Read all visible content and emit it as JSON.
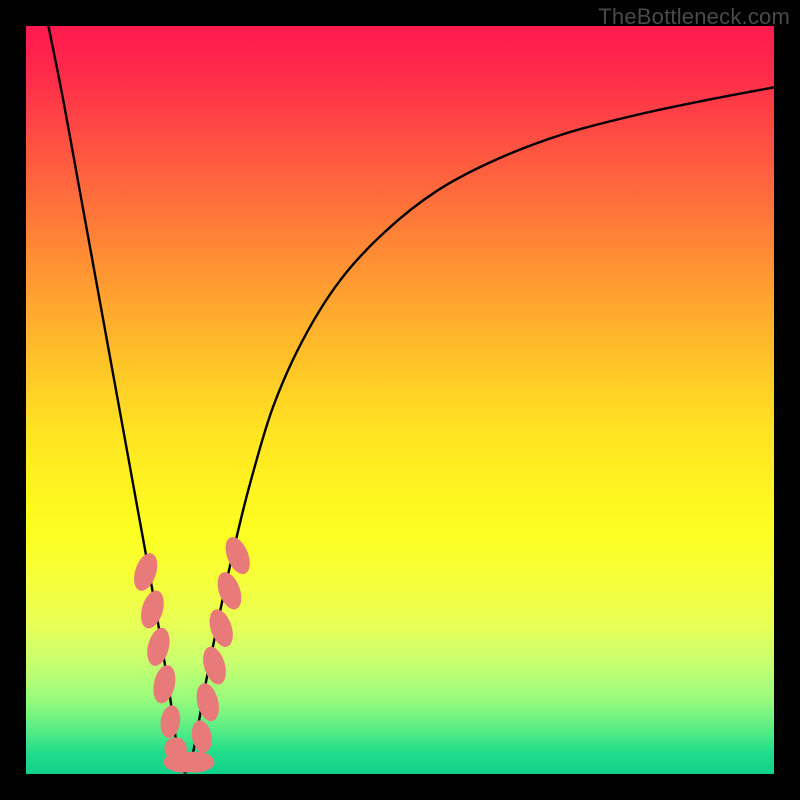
{
  "watermark": "TheBottleneck.com",
  "chart_data": {
    "type": "line",
    "title": "",
    "xlabel": "",
    "ylabel": "",
    "xlim": [
      0,
      100
    ],
    "ylim": [
      0,
      100
    ],
    "grid": false,
    "series": [
      {
        "name": "bottleneck-curve",
        "color": "#000000",
        "x": [
          3,
          5,
          7,
          9,
          11,
          13,
          15,
          17,
          19,
          20.6,
          22,
          24,
          26,
          28,
          30,
          33,
          37,
          42,
          48,
          55,
          63,
          72,
          82,
          92,
          100
        ],
        "values": [
          100,
          90,
          79,
          68,
          57,
          46,
          35,
          24,
          12,
          1.5,
          1.5,
          12,
          22,
          31,
          39,
          49,
          58,
          66,
          72.5,
          78,
          82.2,
          85.6,
          88.2,
          90.3,
          91.8
        ]
      }
    ],
    "markers": {
      "name": "highlight-dots",
      "color": "#e97a7a",
      "points": [
        {
          "x": 16.0,
          "y": 27.0,
          "rx": 1.4,
          "ry": 2.6,
          "rot": 18
        },
        {
          "x": 16.9,
          "y": 22.0,
          "rx": 1.4,
          "ry": 2.6,
          "rot": 16
        },
        {
          "x": 17.7,
          "y": 17.0,
          "rx": 1.4,
          "ry": 2.6,
          "rot": 14
        },
        {
          "x": 18.5,
          "y": 12.0,
          "rx": 1.4,
          "ry": 2.6,
          "rot": 12
        },
        {
          "x": 19.3,
          "y": 7.0,
          "rx": 1.3,
          "ry": 2.2,
          "rot": 8
        },
        {
          "x": 20.0,
          "y": 3.4,
          "rx": 1.5,
          "ry": 1.5,
          "rot": 0
        },
        {
          "x": 21.0,
          "y": 1.6,
          "rx": 2.6,
          "ry": 1.4,
          "rot": 0
        },
        {
          "x": 22.6,
          "y": 1.6,
          "rx": 2.6,
          "ry": 1.4,
          "rot": 0
        },
        {
          "x": 23.5,
          "y": 5.0,
          "rx": 1.3,
          "ry": 2.2,
          "rot": -10
        },
        {
          "x": 24.3,
          "y": 9.6,
          "rx": 1.4,
          "ry": 2.6,
          "rot": -14
        },
        {
          "x": 25.2,
          "y": 14.5,
          "rx": 1.4,
          "ry": 2.6,
          "rot": -16
        },
        {
          "x": 26.1,
          "y": 19.5,
          "rx": 1.4,
          "ry": 2.6,
          "rot": -18
        },
        {
          "x": 27.2,
          "y": 24.5,
          "rx": 1.4,
          "ry": 2.6,
          "rot": -20
        },
        {
          "x": 28.3,
          "y": 29.2,
          "rx": 1.4,
          "ry": 2.6,
          "rot": -22
        }
      ]
    }
  }
}
